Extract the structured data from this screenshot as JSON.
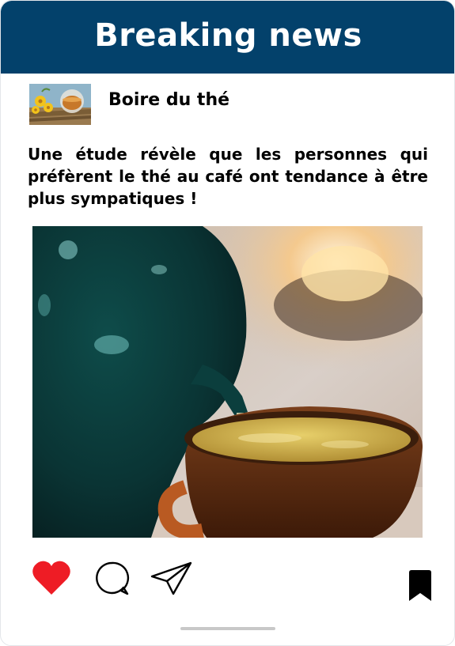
{
  "header": {
    "title": "Breaking news"
  },
  "post": {
    "account_name": "Boire du thé",
    "avatar": {
      "icon": "tea-cup-flowers-thumbnail"
    },
    "caption": "Une étude révèle que les personnes qui préfèrent le thé au café ont tendance à être plus sympatiques !",
    "image": {
      "icon": "teapot-pouring-tea-photo"
    }
  },
  "actions": {
    "like": {
      "icon": "heart-icon",
      "liked": true,
      "color": "#ee1c25"
    },
    "comment": {
      "icon": "comment-icon"
    },
    "share": {
      "icon": "send-icon"
    },
    "save": {
      "icon": "bookmark-icon",
      "saved": true
    }
  },
  "colors": {
    "header_bg": "#03416b",
    "header_text": "#ffffff",
    "like": "#ee1c25",
    "text": "#000000"
  }
}
